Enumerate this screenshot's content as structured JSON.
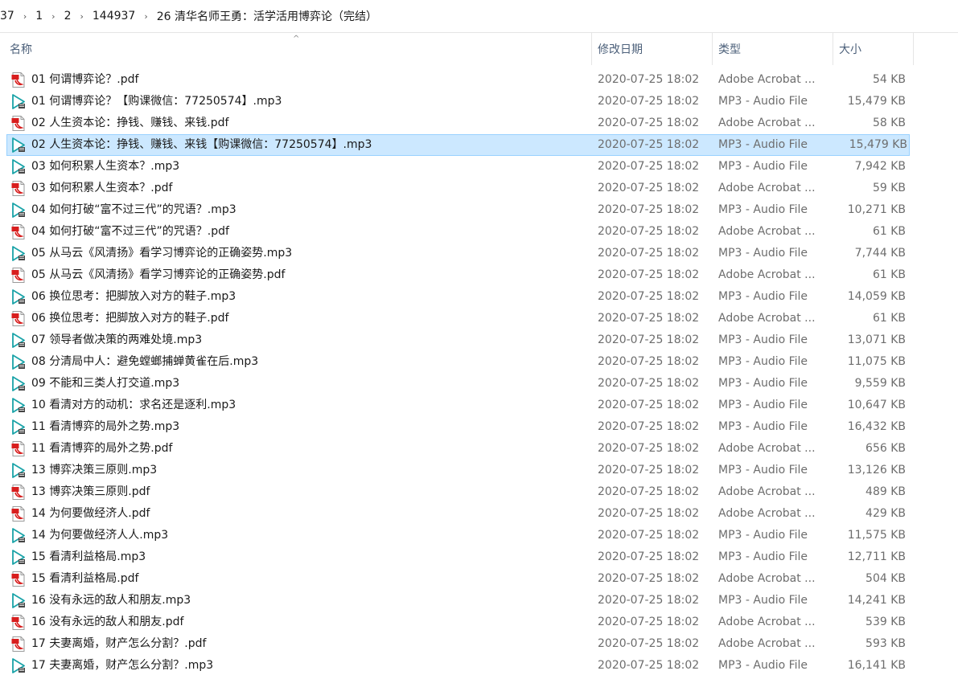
{
  "breadcrumb": [
    "37",
    "1",
    "2",
    "144937",
    "26 清华名师王勇：活学活用博弈论（完结）"
  ],
  "columns": {
    "name": "名称",
    "date": "修改日期",
    "type": "类型",
    "size": "大小"
  },
  "colors": {
    "selected_bg": "#cce8ff",
    "selected_border": "#99d1ff",
    "pdf_icon": "#d81e1e",
    "mp3_icon": "#1aa3a8"
  },
  "files": [
    {
      "name": "01 何谓博弈论？.pdf",
      "date": "2020-07-25 18:02",
      "type": "Adobe Acrobat ...",
      "size": "54 KB",
      "icon": "pdf-icon",
      "selected": false
    },
    {
      "name": "01 何谓博弈论？【购课微信：77250574】.mp3",
      "date": "2020-07-25 18:02",
      "type": "MP3 - Audio File",
      "size": "15,479 KB",
      "icon": "mp3-icon",
      "selected": false
    },
    {
      "name": "02 人生资本论：挣钱、赚钱、来钱.pdf",
      "date": "2020-07-25 18:02",
      "type": "Adobe Acrobat ...",
      "size": "58 KB",
      "icon": "pdf-icon",
      "selected": false
    },
    {
      "name": "02 人生资本论：挣钱、赚钱、来钱【购课微信：77250574】.mp3",
      "date": "2020-07-25 18:02",
      "type": "MP3 - Audio File",
      "size": "15,479 KB",
      "icon": "mp3-icon",
      "selected": true
    },
    {
      "name": "03 如何积累人生资本？.mp3",
      "date": "2020-07-25 18:02",
      "type": "MP3 - Audio File",
      "size": "7,942 KB",
      "icon": "mp3-icon",
      "selected": false
    },
    {
      "name": "03 如何积累人生资本？.pdf",
      "date": "2020-07-25 18:02",
      "type": "Adobe Acrobat ...",
      "size": "59 KB",
      "icon": "pdf-icon",
      "selected": false
    },
    {
      "name": "04 如何打破“富不过三代”的咒语？.mp3",
      "date": "2020-07-25 18:02",
      "type": "MP3 - Audio File",
      "size": "10,271 KB",
      "icon": "mp3-icon",
      "selected": false
    },
    {
      "name": "04 如何打破“富不过三代”的咒语？.pdf",
      "date": "2020-07-25 18:02",
      "type": "Adobe Acrobat ...",
      "size": "61 KB",
      "icon": "pdf-icon",
      "selected": false
    },
    {
      "name": "05 从马云《风清扬》看学习博弈论的正确姿势.mp3",
      "date": "2020-07-25 18:02",
      "type": "MP3 - Audio File",
      "size": "7,744 KB",
      "icon": "mp3-icon",
      "selected": false
    },
    {
      "name": "05 从马云《风清扬》看学习博弈论的正确姿势.pdf",
      "date": "2020-07-25 18:02",
      "type": "Adobe Acrobat ...",
      "size": "61 KB",
      "icon": "pdf-icon",
      "selected": false
    },
    {
      "name": "06 换位思考：把脚放入对方的鞋子.mp3",
      "date": "2020-07-25 18:02",
      "type": "MP3 - Audio File",
      "size": "14,059 KB",
      "icon": "mp3-icon",
      "selected": false
    },
    {
      "name": "06 换位思考：把脚放入对方的鞋子.pdf",
      "date": "2020-07-25 18:02",
      "type": "Adobe Acrobat ...",
      "size": "61 KB",
      "icon": "pdf-icon",
      "selected": false
    },
    {
      "name": "07 领导者做决策的两难处境.mp3",
      "date": "2020-07-25 18:02",
      "type": "MP3 - Audio File",
      "size": "13,071 KB",
      "icon": "mp3-icon",
      "selected": false
    },
    {
      "name": "08 分清局中人：避免螳螂捕蝉黄雀在后.mp3",
      "date": "2020-07-25 18:02",
      "type": "MP3 - Audio File",
      "size": "11,075 KB",
      "icon": "mp3-icon",
      "selected": false
    },
    {
      "name": "09 不能和三类人打交道.mp3",
      "date": "2020-07-25 18:02",
      "type": "MP3 - Audio File",
      "size": "9,559 KB",
      "icon": "mp3-icon",
      "selected": false
    },
    {
      "name": "10 看清对方的动机：求名还是逐利.mp3",
      "date": "2020-07-25 18:02",
      "type": "MP3 - Audio File",
      "size": "10,647 KB",
      "icon": "mp3-icon",
      "selected": false
    },
    {
      "name": "11 看清博弈的局外之势.mp3",
      "date": "2020-07-25 18:02",
      "type": "MP3 - Audio File",
      "size": "16,432 KB",
      "icon": "mp3-icon",
      "selected": false
    },
    {
      "name": "11 看清博弈的局外之势.pdf",
      "date": "2020-07-25 18:02",
      "type": "Adobe Acrobat ...",
      "size": "656 KB",
      "icon": "pdf-icon",
      "selected": false
    },
    {
      "name": "13 博弈决策三原则.mp3",
      "date": "2020-07-25 18:02",
      "type": "MP3 - Audio File",
      "size": "13,126 KB",
      "icon": "mp3-icon",
      "selected": false
    },
    {
      "name": "13 博弈决策三原则.pdf",
      "date": "2020-07-25 18:02",
      "type": "Adobe Acrobat ...",
      "size": "489 KB",
      "icon": "pdf-icon",
      "selected": false
    },
    {
      "name": "14 为何要做经济人.pdf",
      "date": "2020-07-25 18:02",
      "type": "Adobe Acrobat ...",
      "size": "429 KB",
      "icon": "pdf-icon",
      "selected": false
    },
    {
      "name": "14 为何要做经济人人.mp3",
      "date": "2020-07-25 18:02",
      "type": "MP3 - Audio File",
      "size": "11,575 KB",
      "icon": "mp3-icon",
      "selected": false
    },
    {
      "name": "15 看清利益格局.mp3",
      "date": "2020-07-25 18:02",
      "type": "MP3 - Audio File",
      "size": "12,711 KB",
      "icon": "mp3-icon",
      "selected": false
    },
    {
      "name": "15 看清利益格局.pdf",
      "date": "2020-07-25 18:02",
      "type": "Adobe Acrobat ...",
      "size": "504 KB",
      "icon": "pdf-icon",
      "selected": false
    },
    {
      "name": "16 没有永远的敌人和朋友.mp3",
      "date": "2020-07-25 18:02",
      "type": "MP3 - Audio File",
      "size": "14,241 KB",
      "icon": "mp3-icon",
      "selected": false
    },
    {
      "name": "16 没有永远的敌人和朋友.pdf",
      "date": "2020-07-25 18:02",
      "type": "Adobe Acrobat ...",
      "size": "539 KB",
      "icon": "pdf-icon",
      "selected": false
    },
    {
      "name": "17 夫妻离婚，财产怎么分割？.pdf",
      "date": "2020-07-25 18:02",
      "type": "Adobe Acrobat ...",
      "size": "593 KB",
      "icon": "pdf-icon",
      "selected": false
    },
    {
      "name": "17 夫妻离婚，财产怎么分割？.mp3",
      "date": "2020-07-25 18:02",
      "type": "MP3 - Audio File",
      "size": "16,141 KB",
      "icon": "mp3-icon",
      "selected": false
    }
  ]
}
